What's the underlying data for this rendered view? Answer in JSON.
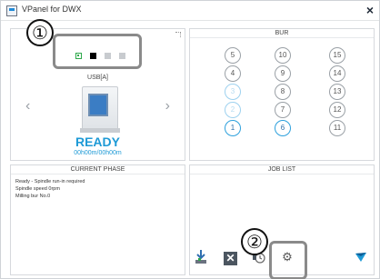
{
  "window": {
    "title": "VPanel for DWX",
    "close_glyph": "×"
  },
  "device_panel": {
    "usb_label": "USB[A]",
    "status": "READY",
    "time": "00h00m/00h00m",
    "left_arrow": "‹",
    "right_arrow": "›"
  },
  "bur_panel": {
    "header": "BUR",
    "burs": [
      "5",
      "10",
      "15",
      "4",
      "9",
      "14",
      "3",
      "8",
      "13",
      "2",
      "7",
      "12",
      "1",
      "6",
      "11"
    ]
  },
  "phase_panel": {
    "header": "CURRENT PHASE",
    "lines": [
      "Ready - Spindle run-in required",
      "Spindle speed   0rpm",
      "Milling bur   No.0"
    ]
  },
  "job_panel": {
    "header": "JOB LIST"
  },
  "toolbar": {
    "x_label": "✕",
    "gear_label": "⚙"
  },
  "annotations": {
    "one": "①",
    "two": "②"
  },
  "colors": {
    "accent": "#1e9ad6",
    "active_dot": "#2da84a",
    "callout_border": "#8a8a8a"
  }
}
